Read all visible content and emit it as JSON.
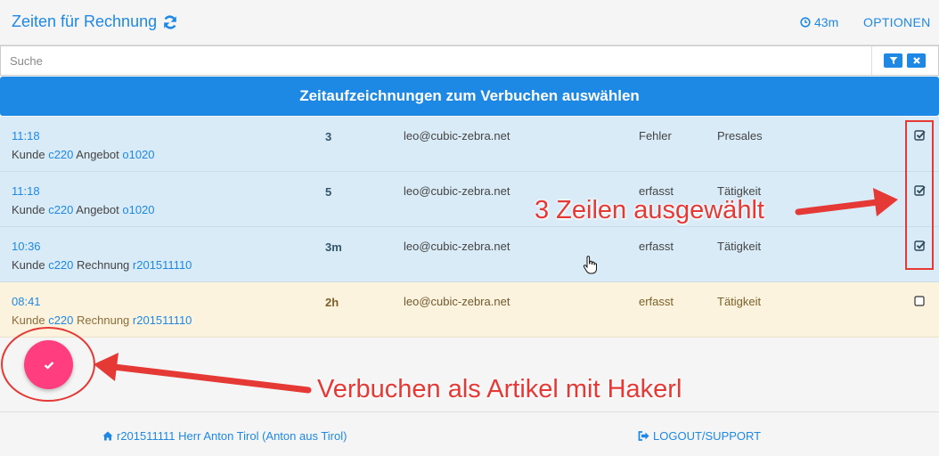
{
  "app": {
    "title": "Zeiten für Rechnung",
    "timer": "43m",
    "options_label": "OPTIONEN"
  },
  "search": {
    "placeholder": "Suche",
    "value": ""
  },
  "header": {
    "title": "Zeitaufzeichnungen zum Verbuchen auswählen"
  },
  "rows": [
    {
      "time": "11:18",
      "desc_prefix": "Kunde ",
      "customer": "c220",
      "desc_mid": " Angebot ",
      "doc": "o1020",
      "duration": "3",
      "email": "leo@cubic-zebra.net",
      "status": "Fehler",
      "category": "Presales",
      "checked": true
    },
    {
      "time": "11:18",
      "desc_prefix": "Kunde ",
      "customer": "c220",
      "desc_mid": " Angebot ",
      "doc": "o1020",
      "duration": "5",
      "email": "leo@cubic-zebra.net",
      "status": "erfasst",
      "category": "Tätigkeit",
      "checked": true
    },
    {
      "time": "10:36",
      "desc_prefix": "Kunde ",
      "customer": "c220",
      "desc_mid": " Rechnung ",
      "doc": "r201511110",
      "duration": "3m",
      "email": "leo@cubic-zebra.net",
      "status": "erfasst",
      "category": "Tätigkeit",
      "checked": true
    },
    {
      "time": "08:41",
      "desc_prefix": "Kunde ",
      "customer": "c220",
      "desc_mid": " Rechnung ",
      "doc": "r201511110",
      "duration": "2h",
      "email": "leo@cubic-zebra.net",
      "status": "erfasst",
      "category": "Tätigkeit",
      "checked": false
    }
  ],
  "annotations": {
    "selected_rows": "3 Zeilen ausgewählt",
    "book_action": "Verbuchen als Artikel mit Hakerl"
  },
  "footer": {
    "user": "r201511111 Herr Anton Tirol (Anton aus Tirol)",
    "logout": "LOGOUT/SUPPORT"
  },
  "colors": {
    "primary": "#1e88e5",
    "selected_row": "#d9ebf7",
    "unselected_row": "#fcf3df",
    "fab": "#ff3d7f",
    "annotation": "#e53935"
  },
  "icons": {
    "refresh": "refresh-icon",
    "timer": "clock-icon",
    "filter": "filter-icon",
    "clear": "close-icon",
    "fab": "check-icon",
    "user": "home-icon",
    "logout": "sign-out-icon"
  }
}
